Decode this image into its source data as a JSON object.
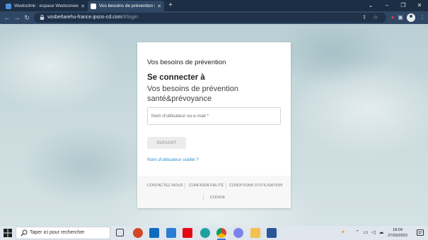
{
  "browser": {
    "tabs": [
      {
        "title": "Wedoolink : espace Wedoonews",
        "favicon_color": "#4a90d9"
      },
      {
        "title": "Vos besoins de prévention santé",
        "favicon_color": "#ffffff"
      }
    ],
    "url_host": "vosbe6arehu-france.ipsos-cd.com",
    "url_path": "/#/login"
  },
  "card": {
    "brand": "Vos besoins de prévention",
    "heading": "Se connecter à",
    "subheading": "Vos besoins de prévention santé&prévoyance",
    "username_placeholder": "Nom d'utilisateur ou e-mail *",
    "next_label": "SUIVANT",
    "forgot_label": "Nom d'utilisateur oublié ?",
    "footer_links": {
      "contact": "CONTACTEZ-NOUS",
      "privacy": "CONFIDENTIALITÉ",
      "terms": "CONDITIONS D'UTILISATION",
      "cookie": "COOKIE"
    }
  },
  "taskbar": {
    "search_placeholder": "Taper ici pour rechercher",
    "time": "18:04",
    "date": "27/02/2023"
  },
  "colors": {
    "accent_link": "#2f8fd0",
    "chrome_dark": "#1c2e44",
    "chrome_toolbar": "#2f4764"
  }
}
